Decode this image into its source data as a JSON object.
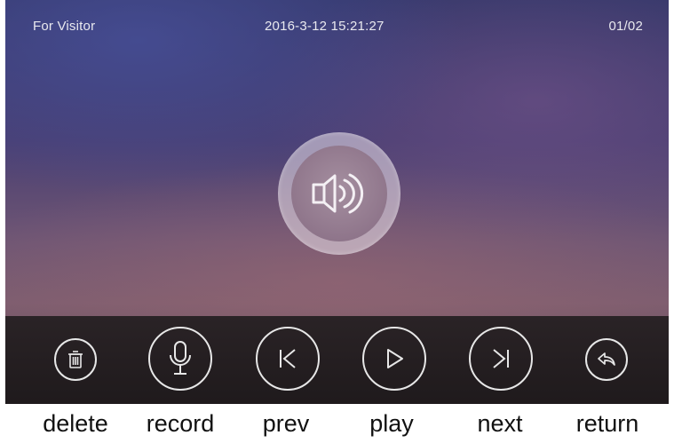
{
  "status_bar": {
    "mode": "For Visitor",
    "datetime": "2016-3-12  15:21:27",
    "page": "01/02"
  },
  "center": {
    "icon": "speaker-playing-icon"
  },
  "toolbar": {
    "buttons": [
      {
        "id": "delete",
        "icon": "trash-icon",
        "label": "delete"
      },
      {
        "id": "record",
        "icon": "microphone-icon",
        "label": "record"
      },
      {
        "id": "prev",
        "icon": "previous-icon",
        "label": "prev"
      },
      {
        "id": "play",
        "icon": "play-icon",
        "label": "play"
      },
      {
        "id": "next",
        "icon": "next-icon",
        "label": "next"
      },
      {
        "id": "return",
        "icon": "return-icon",
        "label": "return"
      }
    ]
  },
  "colors": {
    "icon_stroke": "#e7e7e7",
    "toolbar_bg": "#231d20",
    "caption_text": "#111111"
  }
}
